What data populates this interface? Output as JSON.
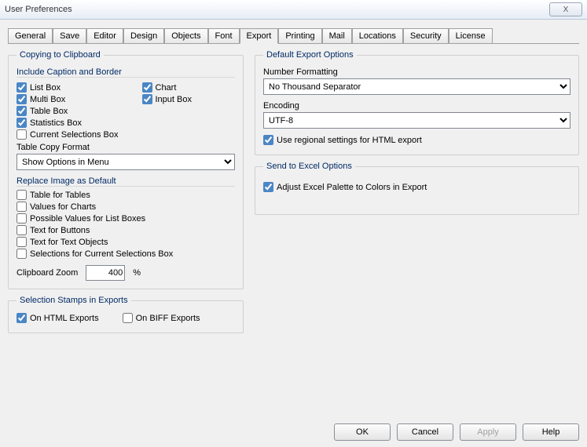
{
  "window": {
    "title": "User Preferences",
    "close": "X"
  },
  "tabs": [
    "General",
    "Save",
    "Editor",
    "Design",
    "Objects",
    "Font",
    "Export",
    "Printing",
    "Mail",
    "Locations",
    "Security",
    "License"
  ],
  "activeTab": "Export",
  "clipboard": {
    "legend": "Copying to Clipboard",
    "include_legend": "Include Caption and Border",
    "cb": {
      "list_box": "List Box",
      "multi_box": "Multi Box",
      "table_box": "Table Box",
      "statistics_box": "Statistics Box",
      "current_selections_box": "Current Selections Box",
      "chart": "Chart",
      "input_box": "Input Box"
    },
    "table_copy_label": "Table Copy Format",
    "table_copy_value": "Show Options in Menu",
    "replace_legend": "Replace Image as Default",
    "replace": {
      "table_for_tables": "Table for Tables",
      "values_for_charts": "Values for Charts",
      "possible_values": "Possible Values for List Boxes",
      "text_buttons": "Text for Buttons",
      "text_objects": "Text for Text Objects",
      "sel_current": "Selections for Current Selections Box"
    },
    "zoom_label": "Clipboard Zoom",
    "zoom_value": "400",
    "zoom_pct": "%"
  },
  "selection_stamps": {
    "legend": "Selection Stamps in Exports",
    "html": "On HTML Exports",
    "biff": "On BIFF Exports"
  },
  "default_export": {
    "legend": "Default Export Options",
    "numfmt_label": "Number Formatting",
    "numfmt_value": "No Thousand Separator",
    "encoding_label": "Encoding",
    "encoding_value": "UTF-8",
    "regional": "Use regional settings for HTML export"
  },
  "excel": {
    "legend": "Send to Excel Options",
    "adjust": "Adjust Excel Palette to Colors in Export"
  },
  "buttons": {
    "ok": "OK",
    "cancel": "Cancel",
    "apply": "Apply",
    "help": "Help"
  }
}
